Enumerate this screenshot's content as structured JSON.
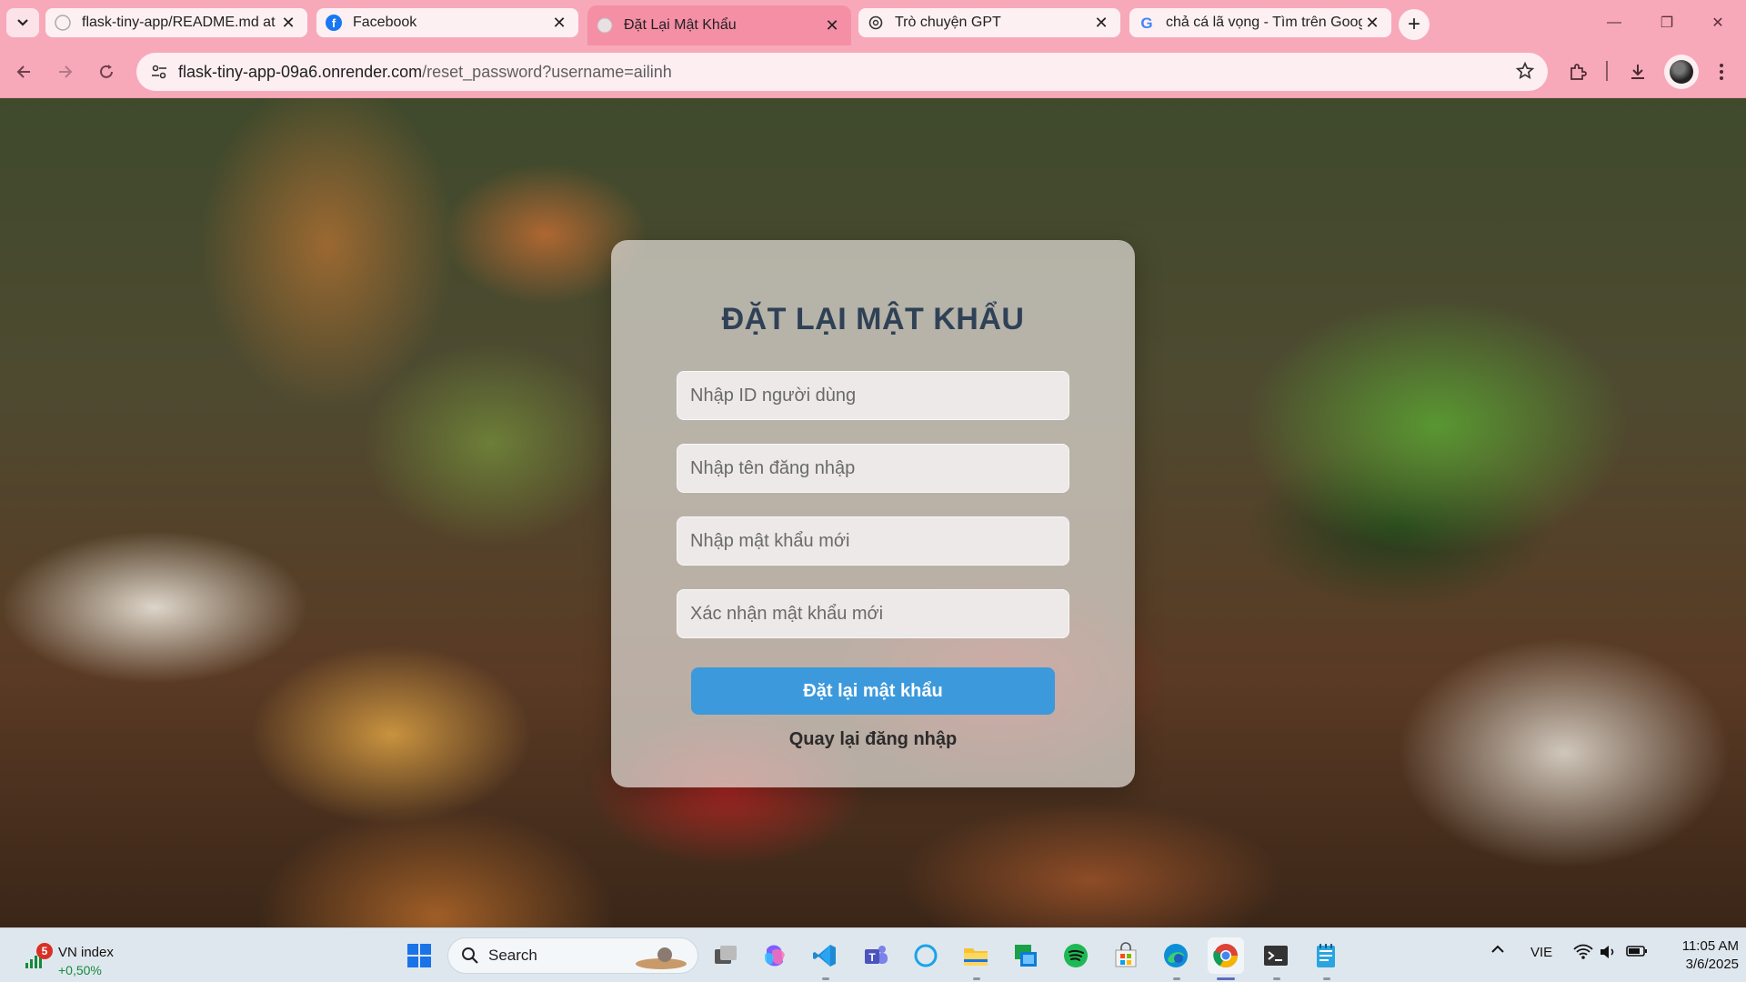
{
  "browser": {
    "tabs": [
      {
        "title": "flask-tiny-app/README.md at m",
        "icon": "github-icon",
        "active": false
      },
      {
        "title": "Facebook",
        "icon": "facebook-icon",
        "active": false
      },
      {
        "title": "Đặt Lại Mật Khẩu",
        "icon": "globe-icon",
        "active": true
      },
      {
        "title": "Trò chuyện GPT",
        "icon": "chatgpt-icon",
        "active": false
      },
      {
        "title": "chả cá lã vọng - Tìm trên Google",
        "icon": "google-icon",
        "active": false
      }
    ],
    "url_host": "flask-tiny-app-09a6.onrender.com",
    "url_path": "/reset_password?username=ailinh",
    "accent_color": "#f7a9b9"
  },
  "page": {
    "title": "ĐẶT LẠI MẬT KHẨU",
    "fields": [
      {
        "placeholder": "Nhập ID người dùng",
        "value": ""
      },
      {
        "placeholder": "Nhập tên đăng nhập",
        "value": ""
      },
      {
        "placeholder": "Nhập mật khẩu mới",
        "value": ""
      },
      {
        "placeholder": "Xác nhận mật khẩu mới",
        "value": ""
      }
    ],
    "submit_label": "Đặt lại mật khẩu",
    "back_link": "Quay lại đăng nhập",
    "button_color": "#3c99dc"
  },
  "taskbar": {
    "widget_title": "VN index",
    "widget_change": "+0,50%",
    "widget_badge": "5",
    "search_label": "Search",
    "language": "VIE",
    "time": "11:05 AM",
    "date": "3/6/2025",
    "apps": [
      "windows-start-icon",
      "task-view-icon",
      "copilot-icon",
      "vscode-icon",
      "teams-icon",
      "cortana-icon",
      "file-explorer-icon",
      "remote-desktop-icon",
      "spotify-icon",
      "microsoft-store-icon",
      "edge-icon",
      "chrome-icon",
      "terminal-icon",
      "notepad-icon"
    ]
  }
}
